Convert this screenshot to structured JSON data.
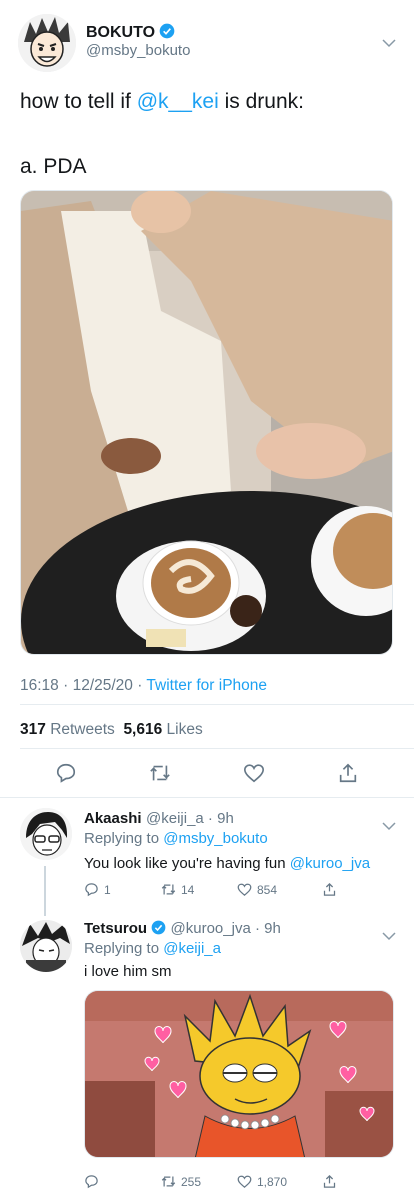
{
  "tweet": {
    "author": {
      "name": "BOKUTO",
      "handle": "@msby_bokuto"
    },
    "text_prefix": "how to tell if ",
    "mention": "@k__kei",
    "text_suffix": " is drunk:",
    "line2": "a. PDA",
    "meta": {
      "time": "16:18",
      "date": "12/25/20",
      "source": "Twitter for iPhone"
    },
    "stats": {
      "retweets_count": "317",
      "retweets_label": "Retweets",
      "likes_count": "5,616",
      "likes_label": "Likes"
    }
  },
  "replies": [
    {
      "name": "Akaashi",
      "handle": "@keiji_a",
      "time": "9h",
      "replying_label": "Replying to",
      "replying_to": "@msby_bokuto",
      "text": "You look like you're having fun ",
      "mention": "@kuroo_jva",
      "actions": {
        "reply": "1",
        "retweet": "14",
        "like": "854"
      }
    },
    {
      "name": "Tetsurou",
      "handle": "@kuroo_jva",
      "time": "9h",
      "replying_label": "Replying to",
      "replying_to": "@keiji_a",
      "text": "i love him sm",
      "actions": {
        "reply": "",
        "retweet": "255",
        "like": "1,870"
      }
    }
  ],
  "colors": {
    "accent": "#1da1f2",
    "muted": "#657786",
    "divider": "#e6ecf0",
    "text": "#14171a"
  },
  "icons": [
    "verified-icon",
    "chevron-down-icon",
    "reply-icon",
    "retweet-icon",
    "like-icon",
    "share-icon"
  ]
}
